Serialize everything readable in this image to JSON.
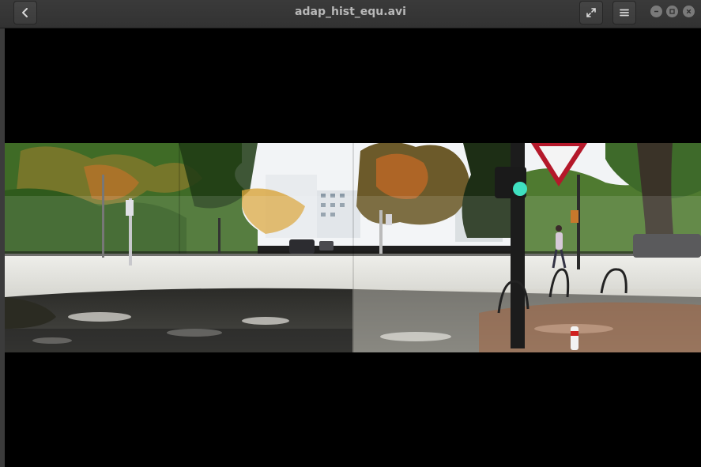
{
  "window": {
    "title": "adap_hist_equ.avi"
  },
  "headerbar": {
    "back_icon": "chevron-left-icon",
    "fullscreen_icon": "expand-icon",
    "menu_icon": "hamburger-menu-icon",
    "window_controls": [
      "minimize-icon",
      "maximize-icon",
      "close-icon"
    ]
  },
  "video": {
    "description_icon": "video-frame",
    "colors": {
      "sky": "#f4f6f8",
      "foliage": "#3d6e2a",
      "road": "#d9d9d4",
      "asphalt": "#3a3a36"
    }
  }
}
